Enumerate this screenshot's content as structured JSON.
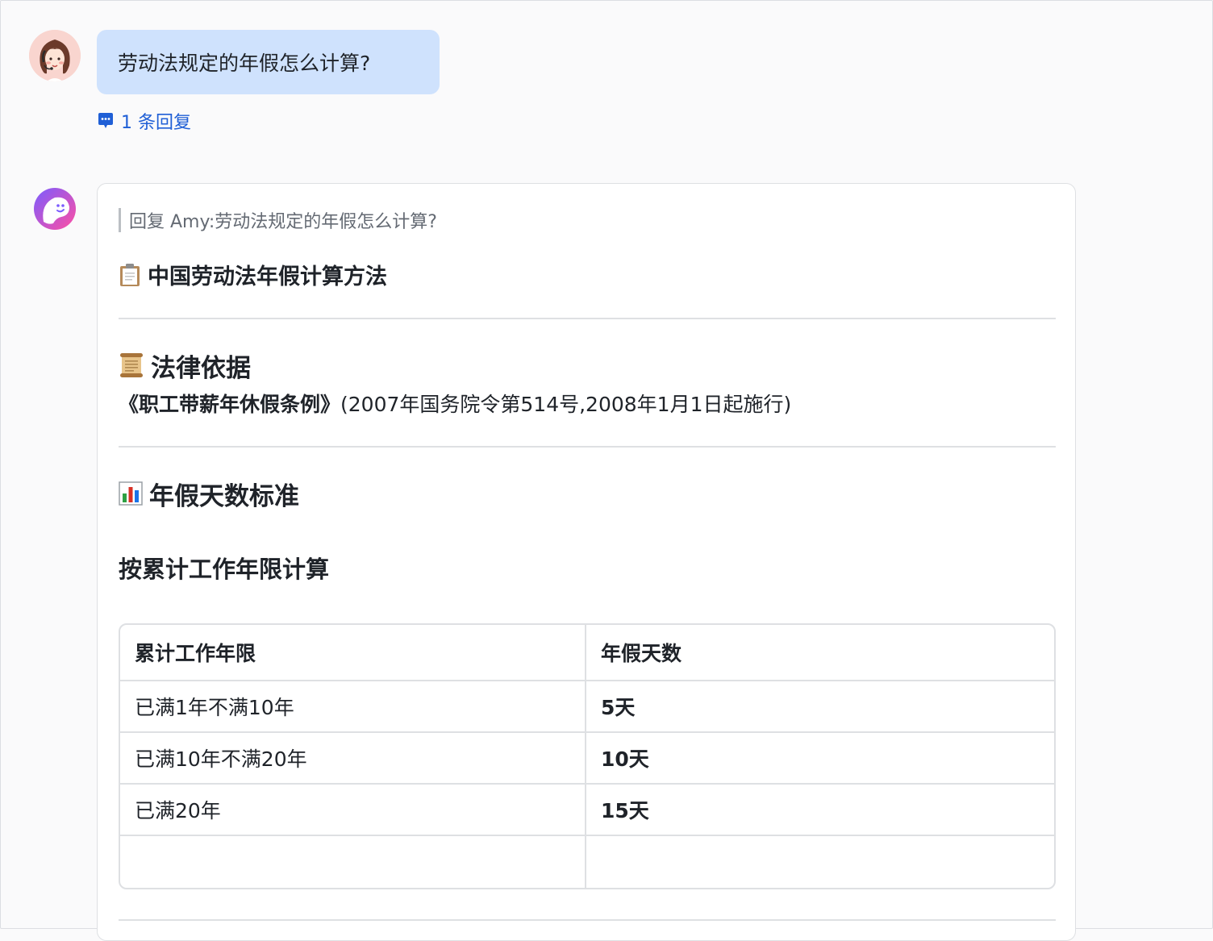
{
  "user_message": {
    "text": "劳动法规定的年假怎么计算?",
    "reply_count_label": "1 条回复"
  },
  "bot_message": {
    "quote": "回复 Amy:劳动法规定的年假怎么计算?",
    "title": "中国劳动法年假计算方法",
    "title_icon": "clipboard-icon",
    "law_section": {
      "heading": "法律依据",
      "icon": "scroll-icon",
      "regulation_name": "《职工带薪年休假条例》",
      "regulation_note": "(2007年国务院令第514号,2008年1月1日起施行)"
    },
    "standard_section": {
      "heading": "年假天数标准",
      "icon": "bar-chart-icon",
      "subheading": "按累计工作年限计算",
      "table": {
        "headers": [
          "累计工作年限",
          "年假天数"
        ],
        "rows": [
          [
            "已满1年不满10年",
            "5天"
          ],
          [
            "已满10年不满20年",
            "10天"
          ],
          [
            "已满20年",
            "15天"
          ],
          [
            "",
            ""
          ]
        ]
      }
    }
  },
  "colors": {
    "user_bubble": "#cfe2fd",
    "link": "#1f5fd6",
    "divider": "#dee0e3",
    "bot_avatar_gradient": [
      "#7b5cff",
      "#ff4fa3"
    ]
  }
}
